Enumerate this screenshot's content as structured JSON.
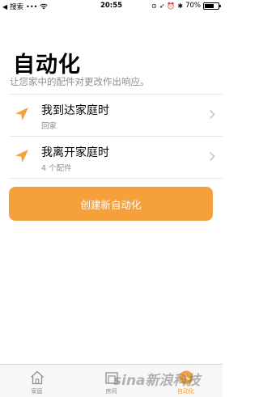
{
  "status_bar": {
    "back_label": "搜索",
    "time": "20:55",
    "battery": "70%",
    "battery_level": 0.7
  },
  "header": {
    "title": "自动化",
    "subtitle": "让您家中的配件对更改作出响应。"
  },
  "automations": [
    {
      "title": "我到达家庭时",
      "subtitle": "回家",
      "icon": "location-arrow-icon"
    },
    {
      "title": "我离开家庭时",
      "subtitle": "4 个配件",
      "icon": "location-arrow-icon"
    }
  ],
  "create_button_label": "创建新自动化",
  "tabs": [
    {
      "label": "家庭",
      "icon": "home-icon",
      "active": false
    },
    {
      "label": "房间",
      "icon": "rooms-icon",
      "active": false
    },
    {
      "label": "自动化",
      "icon": "automation-clock-icon",
      "active": true
    }
  ],
  "watermark": "sina新浪科技",
  "colors": {
    "accent": "#f5a03b",
    "secondary_text": "#8e8e93",
    "divider": "#e3e3e8"
  }
}
